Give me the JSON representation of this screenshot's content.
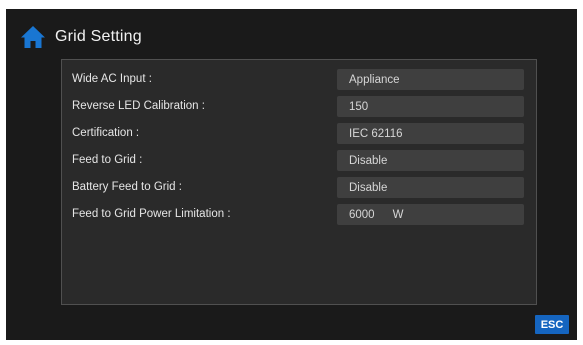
{
  "header": {
    "title": "Grid Setting",
    "home_icon": "home-icon",
    "home_icon_color": "#1976d2"
  },
  "settings": [
    {
      "label": "Wide AC Input :",
      "value": "Appliance",
      "unit": ""
    },
    {
      "label": "Reverse LED Calibration :",
      "value": "150",
      "unit": ""
    },
    {
      "label": "Certification :",
      "value": "IEC 62116",
      "unit": ""
    },
    {
      "label": "Feed to Grid :",
      "value": "Disable",
      "unit": ""
    },
    {
      "label": "Battery Feed to Grid :",
      "value": "Disable",
      "unit": ""
    },
    {
      "label": "Feed to Grid Power Limitation :",
      "value": "6000",
      "unit": "W"
    }
  ],
  "footer": {
    "esc_label": "ESC",
    "esc_color": "#1565c0"
  }
}
